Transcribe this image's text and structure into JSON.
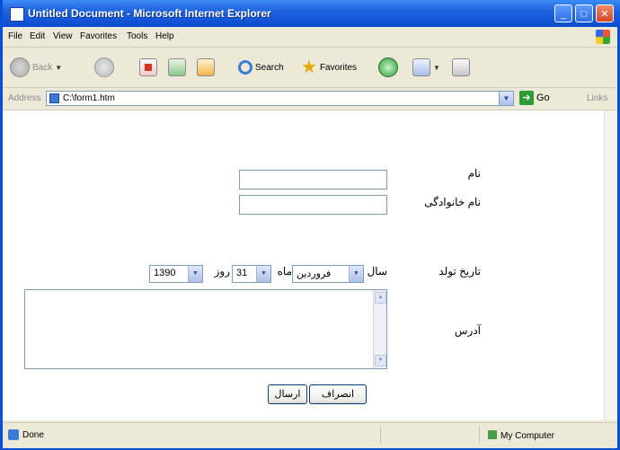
{
  "window": {
    "title": "Untitled Document - Microsoft Internet Explorer",
    "controls": {
      "minimize": "_",
      "maximize": "□",
      "close": "✕"
    }
  },
  "menubar": {
    "items": [
      "File",
      "Edit",
      "View",
      "Favorites",
      "Tools",
      "Help"
    ]
  },
  "toolbar": {
    "back_label": "Back",
    "search_label": "Search",
    "favorites_label": "Favorites",
    "icons": [
      "back-icon",
      "forward-icon",
      "stop-icon",
      "refresh-icon",
      "home-icon",
      "search-icon",
      "favorites-star-icon",
      "history-icon",
      "mail-icon",
      "print-icon"
    ]
  },
  "addressbar": {
    "label": "Address",
    "url": "C:\\form1.htm",
    "go_label": "Go",
    "links_label": "Links"
  },
  "form": {
    "name_label": "نام",
    "family_label": "نام خانوادگی",
    "name_value": "",
    "family_value": "",
    "birth_label": "تاریخ تولد",
    "year_label": "سال",
    "month_label": "ماه",
    "day_label": "روز",
    "month_value": "فروردین",
    "day_value": "31",
    "year_value": "1390",
    "address_label": "آدرس",
    "address_value": "",
    "submit_label": "ارسال",
    "cancel_label": "انصراف"
  },
  "statusbar": {
    "status": "Done",
    "zone": "My Computer"
  }
}
